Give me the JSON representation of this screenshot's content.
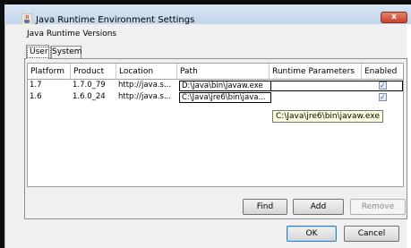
{
  "window": {
    "title": "Java Runtime Environment Settings",
    "close_label": "x"
  },
  "subtitle": "Java Runtime Versions",
  "tabs": [
    {
      "label": "User",
      "selected": true
    },
    {
      "label": "System",
      "selected": false
    }
  ],
  "table": {
    "columns": [
      "Platform",
      "Product",
      "Location",
      "Path",
      "Runtime Parameters",
      "Enabled"
    ],
    "rows": [
      {
        "platform": "1.7",
        "product": "1.7.0_79",
        "location": "http://java.s...",
        "path": "D:\\java\\bin\\javaw.exe",
        "runtime_parameters": "",
        "enabled": true
      },
      {
        "platform": "1.6",
        "product": "1.6.0_24",
        "location": "http://java.s...",
        "path": "C:\\Java\\jre6\\bin\\java...",
        "runtime_parameters": "",
        "enabled": true
      }
    ]
  },
  "tooltip": "C:\\Java\\jre6\\bin\\javaw.exe",
  "buttons": {
    "find": "Find",
    "add": "Add",
    "remove": "Remove",
    "ok": "OK",
    "cancel": "Cancel"
  },
  "icons": {
    "app": "java-cup-icon",
    "close": "close-icon",
    "check": "checkbox-checked-icon"
  },
  "colors": {
    "titlebar": "#c3d6ea",
    "close_button": "#c8432a",
    "tooltip_bg": "#ffffe1",
    "check": "#3b5a8c"
  }
}
